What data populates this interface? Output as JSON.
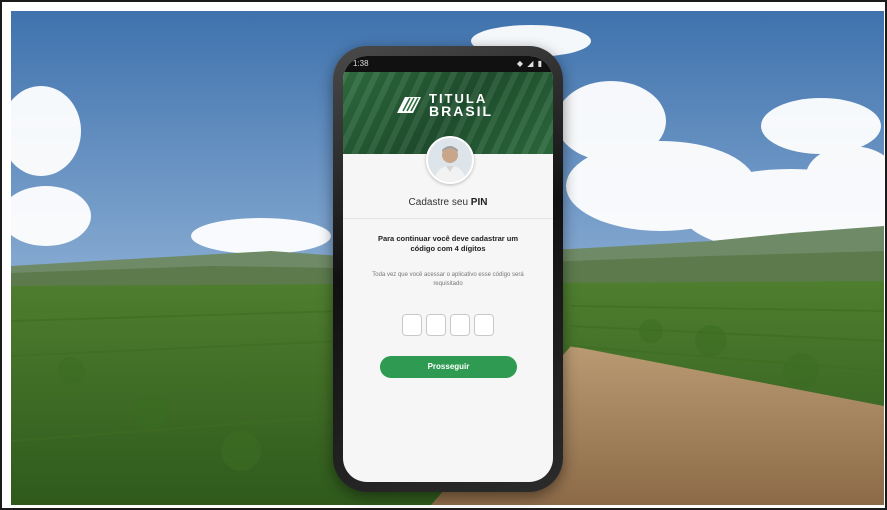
{
  "status_bar": {
    "time": "1:38",
    "icons": "◆ ◢ ▮"
  },
  "app": {
    "brand_line1": "TITULA",
    "brand_line2": "BRASIL",
    "title_prefix": "Cadastre seu ",
    "title_strong": "PIN",
    "instruction": "Para continuar você deve cadastrar um código com 4 dígitos",
    "helper": "Toda vez que você acessar o aplicativo esse código será requisitado",
    "pin_boxes": [
      "",
      "",
      "",
      ""
    ],
    "continue_label": "Prosseguir"
  },
  "colors": {
    "brand_green": "#2e9a52",
    "header_green": "#2f6e3f"
  }
}
